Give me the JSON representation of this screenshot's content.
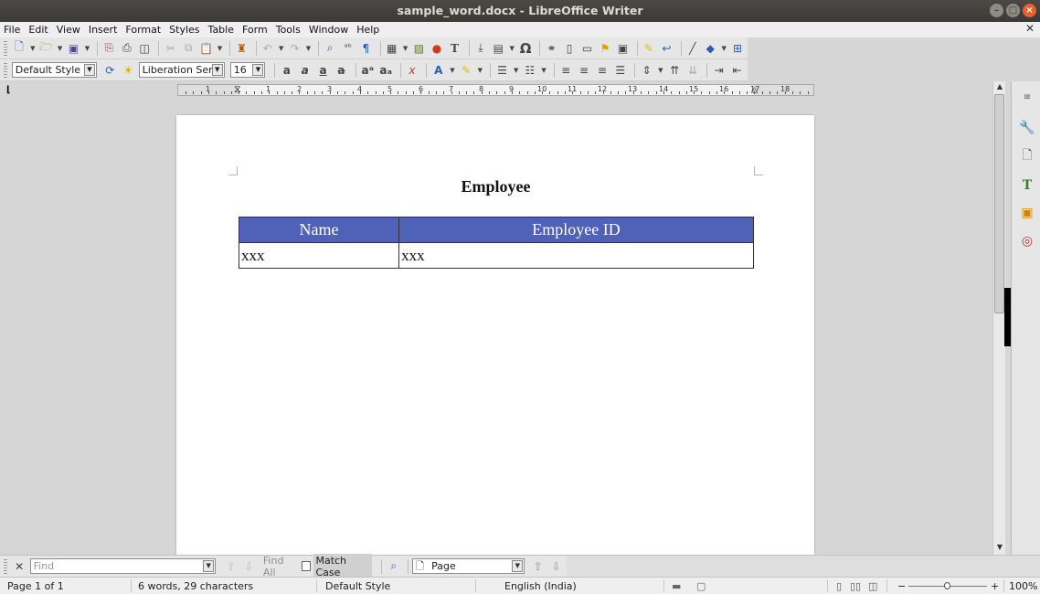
{
  "window": {
    "title": "sample_word.docx - LibreOffice Writer"
  },
  "menu": [
    "File",
    "Edit",
    "View",
    "Insert",
    "Format",
    "Styles",
    "Table",
    "Form",
    "Tools",
    "Window",
    "Help"
  ],
  "formatting": {
    "paragraph_style": "Default Style",
    "font_name": "Liberation Serif",
    "font_size": "16"
  },
  "ruler": {
    "numbers": [
      "1",
      "1",
      "2",
      "3",
      "4",
      "5",
      "6",
      "7",
      "8",
      "9",
      "10",
      "11",
      "12",
      "13",
      "14",
      "15",
      "16",
      "17",
      "18"
    ]
  },
  "document": {
    "title": "Employee",
    "table": {
      "headers": [
        "Name",
        "Employee ID"
      ],
      "rows": [
        [
          "xxx",
          "xxx"
        ]
      ],
      "header_color": "#5061b8"
    }
  },
  "find_toolbar": {
    "find_placeholder": "Find",
    "find_all": "Find All",
    "match_case": "Match Case",
    "search_by": "Page"
  },
  "status": {
    "page": "Page 1 of 1",
    "words": "6 words, 29 characters",
    "page_style": "Default Style",
    "language": "English (India)",
    "zoom": "100%"
  }
}
